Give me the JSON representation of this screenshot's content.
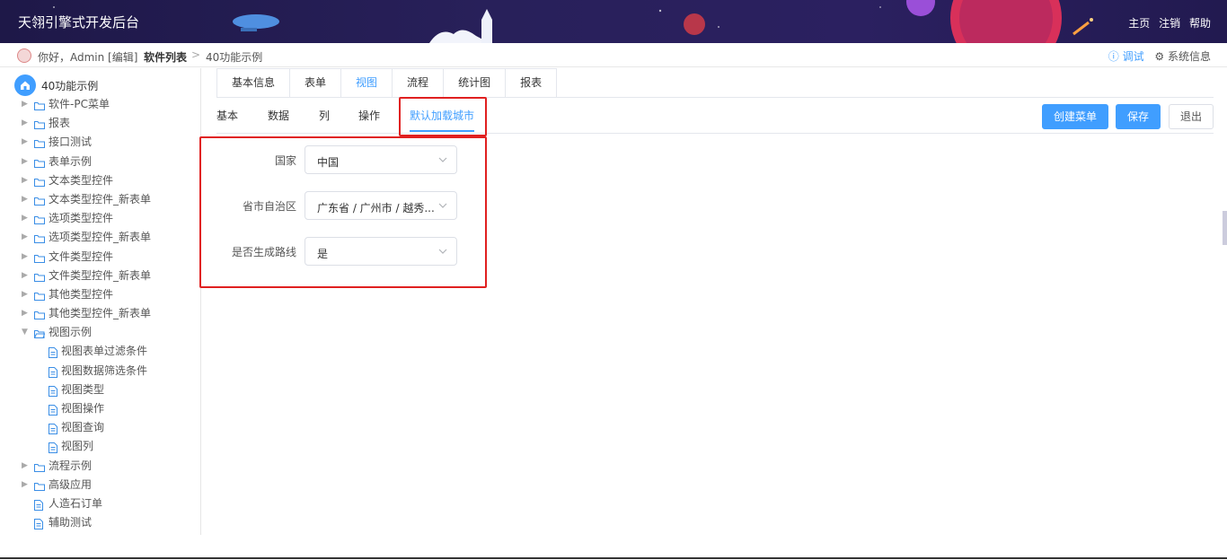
{
  "header": {
    "title": "天翎引擎式开发后台",
    "links": [
      "主页",
      "注销",
      "帮助"
    ]
  },
  "crumb": {
    "hello": "你好，Admin [编辑]",
    "current": "软件列表",
    "separator": ">",
    "page": "40功能示例",
    "debug": "ⓘ 调试",
    "system": "⚙ 系统信息"
  },
  "sidebar": {
    "root": "40功能示例",
    "items": [
      {
        "label": "软件-PC菜单",
        "type": "folder"
      },
      {
        "label": "报表",
        "type": "folder"
      },
      {
        "label": "接口测试",
        "type": "folder"
      },
      {
        "label": "表单示例",
        "type": "folder"
      },
      {
        "label": "文本类型控件",
        "type": "folder"
      },
      {
        "label": "文本类型控件_新表单",
        "type": "folder"
      },
      {
        "label": "选项类型控件",
        "type": "folder"
      },
      {
        "label": "选项类型控件_新表单",
        "type": "folder"
      },
      {
        "label": "文件类型控件",
        "type": "folder"
      },
      {
        "label": "文件类型控件_新表单",
        "type": "folder"
      },
      {
        "label": "其他类型控件",
        "type": "folder"
      },
      {
        "label": "其他类型控件_新表单",
        "type": "folder"
      },
      {
        "label": "视图示例",
        "type": "folder-open"
      },
      {
        "label": "视图表单过滤条件",
        "type": "file"
      },
      {
        "label": "视图数据筛选条件",
        "type": "file"
      },
      {
        "label": "视图类型",
        "type": "file"
      },
      {
        "label": "视图操作",
        "type": "file"
      },
      {
        "label": "视图查询",
        "type": "file"
      },
      {
        "label": "视图列",
        "type": "file"
      },
      {
        "label": "流程示例",
        "type": "folder"
      },
      {
        "label": "高级应用",
        "type": "folder"
      },
      {
        "label": "人造石订单",
        "type": "file-root"
      },
      {
        "label": "辅助测试",
        "type": "file-root"
      }
    ]
  },
  "tabs": [
    "基本信息",
    "表单",
    "视图",
    "流程",
    "统计图",
    "报表"
  ],
  "subtabs": [
    "基本",
    "数据",
    "列",
    "操作",
    "默认加载城市"
  ],
  "buttons": {
    "create": "创建菜单",
    "save": "保存",
    "exit": "退出"
  },
  "form": [
    {
      "label": "国家",
      "value": "中国"
    },
    {
      "label": "省市自治区",
      "value": "广东省 / 广州市 / 越秀..."
    },
    {
      "label": "是否生成路线",
      "value": "是"
    }
  ]
}
